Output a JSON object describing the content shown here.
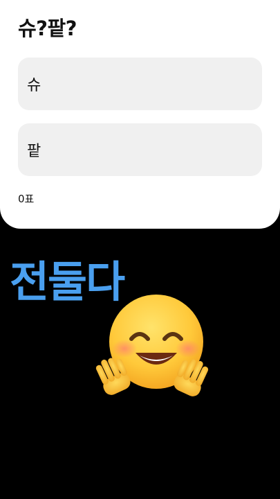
{
  "poll": {
    "title": "슈?팥?",
    "options": [
      {
        "label": "슈"
      },
      {
        "label": "팥"
      }
    ],
    "vote_count": "0표"
  },
  "overlay": {
    "text": "전둘다",
    "color": "#4a9fef"
  },
  "emoji": {
    "name": "hugging-face-icon"
  },
  "colors": {
    "background": "#000000",
    "card": "#ffffff",
    "option_bg": "#f0f0f0"
  }
}
